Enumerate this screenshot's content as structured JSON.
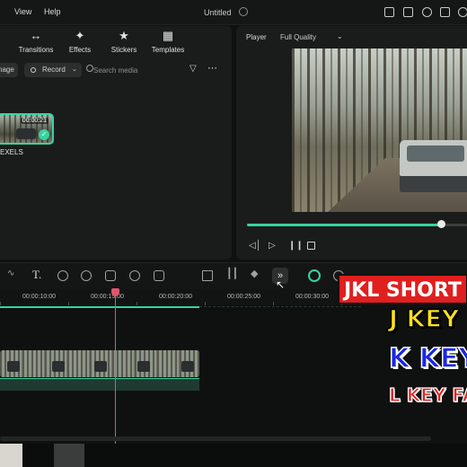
{
  "menu": {
    "view": "View",
    "help": "Help"
  },
  "window": {
    "title": "Untitled"
  },
  "media_panel": {
    "tabs": [
      {
        "label": "Transitions",
        "icon": "transitions-icon"
      },
      {
        "label": "Effects",
        "icon": "effects-icon"
      },
      {
        "label": "Stickers",
        "icon": "stickers-icon"
      },
      {
        "label": "Templates",
        "icon": "templates-icon"
      }
    ],
    "import_label": "nage",
    "record_label": "Record",
    "search_placeholder": "Search media",
    "clip": {
      "duration": "00:00:21",
      "label": "EXELS"
    }
  },
  "player": {
    "label": "Player",
    "quality": "Full Quality",
    "progress": 0.88
  },
  "timeline": {
    "ticks": [
      "00:00:10:00",
      "00:00:15:00",
      "00:00:20:00",
      "00:00:25:00",
      "00:00:30:00"
    ]
  },
  "overlay": {
    "title": "JKL SHORT",
    "j_line": "J KEY",
    "k_line": "K KEY",
    "l_line": "L KEY FA"
  },
  "colors": {
    "accent": "#38d39f",
    "playhead": "#e0566a",
    "overlay_red": "#e01f1f",
    "overlay_yellow": "#ffe21a",
    "overlay_blue": "#1b27e0"
  }
}
